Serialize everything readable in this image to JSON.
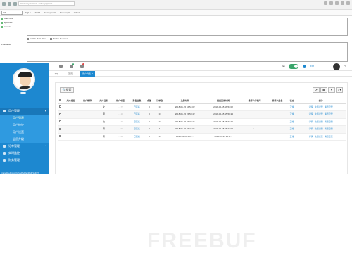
{
  "browser": {
    "url": "/cmseasy/admin/…/index.php?m=…"
  },
  "hackbar": {
    "select_value": "INT",
    "menu": [
      "SQL▾",
      "XSS▾",
      "Encryption▾",
      "Encoding▾",
      "Other▾"
    ],
    "side": [
      "Load URL",
      "Split URL",
      "Execute"
    ],
    "checks": [
      "Enable Post data",
      "Enable Referrer"
    ],
    "post_label": "Post data"
  },
  "sidebar": {
    "menu": [
      {
        "label": "用户管理",
        "arrow": "▾"
      },
      {
        "label": "用户列表"
      },
      {
        "label": "用户统计"
      },
      {
        "label": "用户设置"
      },
      {
        "label": "会员升级"
      },
      {
        "label": "订单管理",
        "arrow": "‹"
      },
      {
        "label": "实时监控",
        "arrow": "‹"
      },
      {
        "label": "财务管理",
        "arrow": "‹"
      }
    ],
    "footer_url": "mmedia.dmsgz/ig/ssdfsdf/s/4fsdf/1s4/2f"
  },
  "topbar": {
    "toggle_label": "Tab",
    "user_text": "在线"
  },
  "tabs": [
    {
      "label": "◀◀"
    },
    {
      "label": "首页"
    },
    {
      "label": "用户列表 ✕"
    }
  ],
  "panel": {
    "search_label": "🔍搜索",
    "tools": [
      "⟳",
      "▦",
      "▾",
      "⇩▾"
    ]
  },
  "table": {
    "headers": [
      "",
      "用户姓名",
      "用户昵称",
      "用户性别",
      "用户电话",
      "实名信息",
      "余额",
      "订单数",
      "注册时间",
      "最后登录时间",
      "推荐人手机号",
      "推荐人姓名",
      "状态",
      "操作"
    ],
    "rows": [
      [
        "",
        "",
        "",
        "女",
        "1…77",
        "已实名",
        "0",
        "0",
        "2018-05-15 16:54:02",
        "2018-05-15 16:54:02",
        "",
        "",
        "正常",
        "详情 充值记录 消费记录"
      ],
      [
        "",
        "",
        "",
        "男",
        "1…15",
        "已实名",
        "0",
        "0",
        "2018-05-15 15:50:42",
        "2018-05-15 15:50:23",
        "",
        "",
        "正常",
        "详情 充值记录 消费记录"
      ],
      [
        "",
        "",
        "",
        "女",
        "1…72",
        "已实名",
        "0",
        "0",
        "2018-05-15 15:37:25",
        "2018-05-15 15:37:25",
        "",
        "",
        "正常",
        "详情 充值记录 消费记录"
      ],
      [
        "",
        "",
        "",
        "男",
        "1…95",
        "已实名",
        "0",
        "1",
        "2018-05-15 15:24:06",
        "2018-05-15 15:24:04",
        "1…",
        "",
        "正常",
        "详情 充值记录 消费记录"
      ],
      [
        "",
        "",
        "",
        "男",
        "1…43",
        "已实名",
        "0",
        "0",
        "2018-05-15 15:0…",
        "2018-05-15 15:0…",
        "",
        "",
        "正常",
        "详情 充值记录 消费记录"
      ]
    ]
  },
  "watermark": "FREEBUF"
}
